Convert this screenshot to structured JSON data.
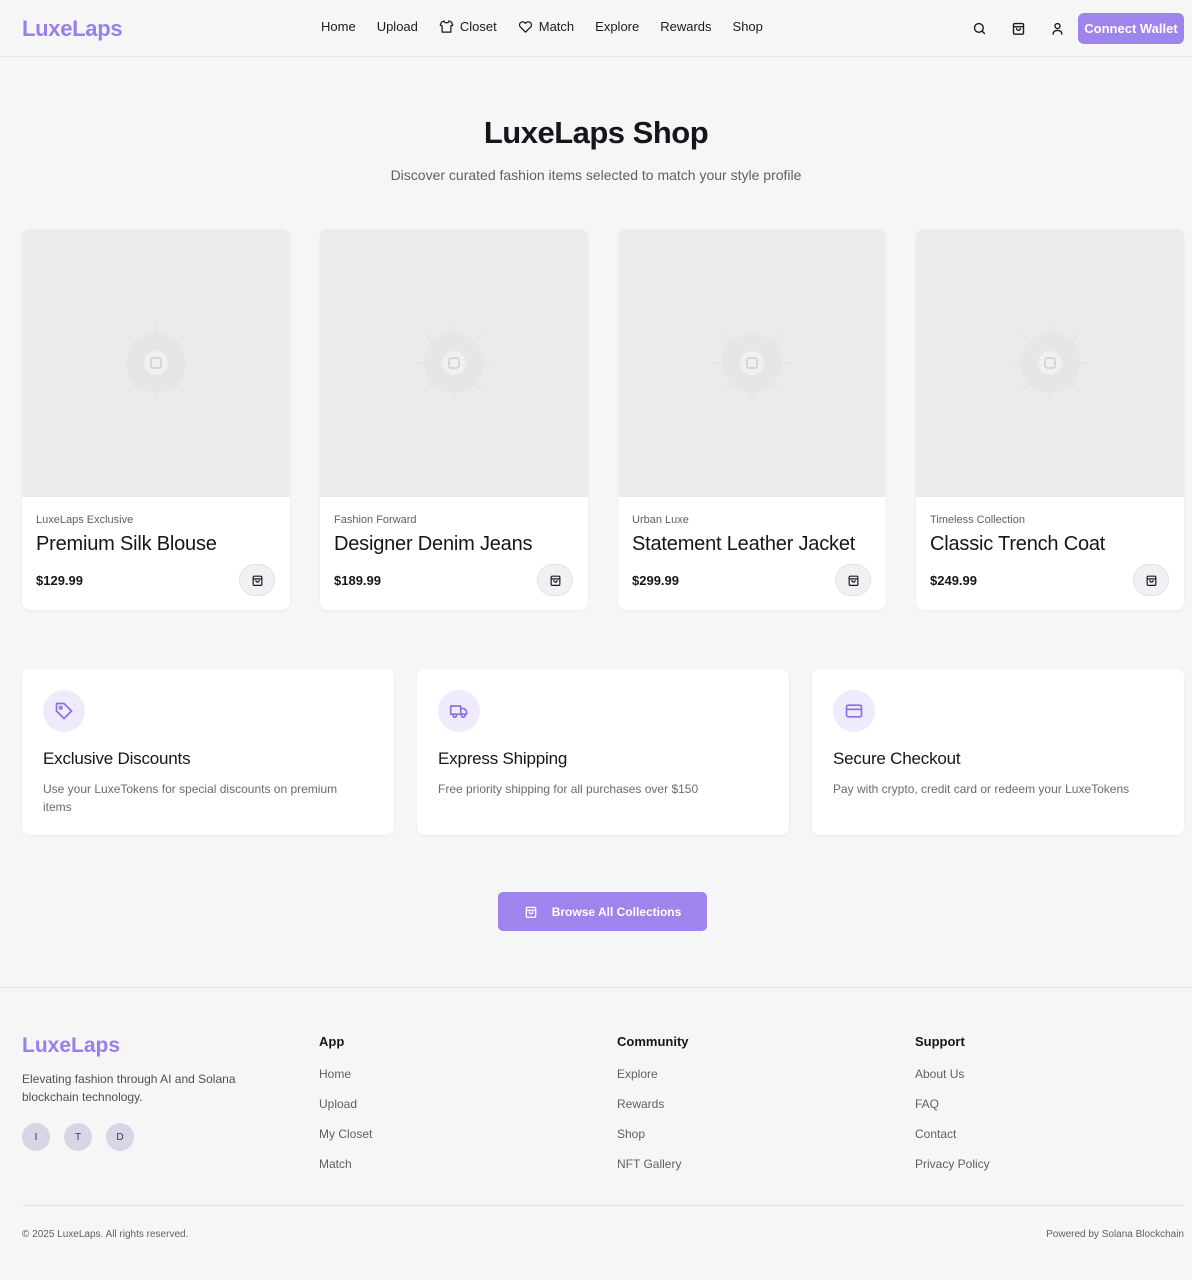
{
  "header": {
    "logo": "LuxeLaps",
    "nav": [
      {
        "label": "Home",
        "icon": ""
      },
      {
        "label": "Upload",
        "icon": ""
      },
      {
        "label": "Closet",
        "icon": "shirt-icon"
      },
      {
        "label": "Match",
        "icon": "heart-icon"
      },
      {
        "label": "Explore",
        "icon": ""
      },
      {
        "label": "Rewards",
        "icon": ""
      },
      {
        "label": "Shop",
        "icon": ""
      }
    ],
    "icons": [
      "search-icon",
      "shopping-bag-icon",
      "user-icon"
    ],
    "connect_label": "Connect Wallet"
  },
  "hero": {
    "title": "LuxeLaps Shop",
    "subtitle": "Discover curated fashion items selected to match your style profile"
  },
  "products": [
    {
      "brand": "LuxeLaps Exclusive",
      "name": "Premium Silk Blouse",
      "price": "$129.99"
    },
    {
      "brand": "Fashion Forward",
      "name": "Designer Denim Jeans",
      "price": "$189.99"
    },
    {
      "brand": "Urban Luxe",
      "name": "Statement Leather Jacket",
      "price": "$299.99"
    },
    {
      "brand": "Timeless Collection",
      "name": "Classic Trench Coat",
      "price": "$249.99"
    }
  ],
  "features": [
    {
      "icon": "tag-icon",
      "title": "Exclusive Discounts",
      "text": "Use your LuxeTokens for special discounts on premium items"
    },
    {
      "icon": "truck-icon",
      "title": "Express Shipping",
      "text": "Free priority shipping for all purchases over $150"
    },
    {
      "icon": "credit-card-icon",
      "title": "Secure Checkout",
      "text": "Pay with crypto, credit card or redeem your LuxeTokens"
    }
  ],
  "browse_label": "Browse All Collections",
  "footer": {
    "logo": "LuxeLaps",
    "tagline": "Elevating fashion through AI and Solana blockchain technology.",
    "socials": [
      "I",
      "T",
      "D"
    ],
    "columns": [
      {
        "title": "App",
        "links": [
          "Home",
          "Upload",
          "My Closet",
          "Match"
        ]
      },
      {
        "title": "Community",
        "links": [
          "Explore",
          "Rewards",
          "Shop",
          "NFT Gallery"
        ]
      },
      {
        "title": "Support",
        "links": [
          "About Us",
          "FAQ",
          "Contact",
          "Privacy Policy"
        ]
      }
    ],
    "copyright": "© 2025 LuxeLaps. All rights reserved.",
    "powered": "Powered by Solana Blockchain"
  },
  "colors": {
    "accent": "#9f84ee",
    "logo": "#9a7fe6",
    "background": "#f6f6f7"
  }
}
